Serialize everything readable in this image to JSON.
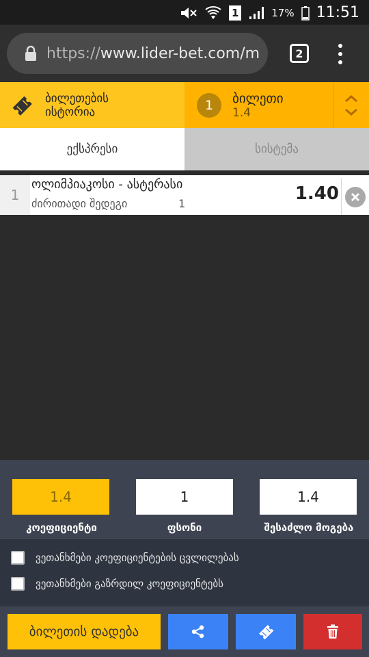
{
  "status_bar": {
    "battery_percent": "17%",
    "time": "11:51",
    "sim_badge": "1"
  },
  "browser": {
    "url_scheme": "https://",
    "url_host": "www.lider-bet.com/m",
    "tab_count": "2"
  },
  "ticket_header": {
    "history_label": "ბილეთების ისტორია",
    "ticket_count": "1",
    "ticket_title": "ბილეთი",
    "ticket_odds": "1.4"
  },
  "mode_tabs": {
    "express": "ექსპრესი",
    "system": "სისტემა"
  },
  "bets": [
    {
      "index": "1",
      "match": "ოლიმპიაკოსი - ასტერასი",
      "market": "ძირითადი შედეგი",
      "pick": "1",
      "odds": "1.40"
    }
  ],
  "stake": {
    "odds_value": "1.4",
    "odds_label": "კოეფიციენტი",
    "stake_value": "1",
    "stake_label": "ფსონი",
    "win_value": "1.4",
    "win_label": "შესაძლო მოგება"
  },
  "agreements": {
    "accept_changes": "ვეთანხმები კოეფიციენტების ცვლილებას",
    "accept_increased": "ვეთანხმები გაზრდილ კოეფიციენტებს"
  },
  "actions": {
    "place_bet": "ბილეთის დადება"
  },
  "colors": {
    "accent_yellow": "#ffc107",
    "action_blue": "#3b82f6",
    "delete_red": "#d32f2f"
  }
}
